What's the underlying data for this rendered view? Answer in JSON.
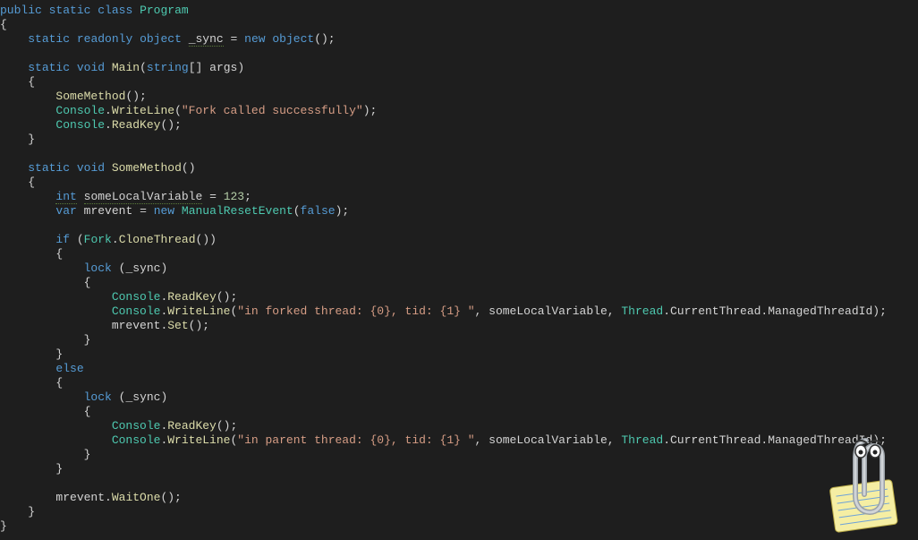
{
  "code": {
    "l1": {
      "kw1": "public",
      "kw2": "static",
      "kw3": "class",
      "name": "Program"
    },
    "l2": "{",
    "l3": {
      "kw1": "static",
      "kw2": "readonly",
      "kw3": "object",
      "field": "_sync",
      "op": "=",
      "kw4": "new",
      "kw5": "object",
      "tail": "();"
    },
    "l5": {
      "kw1": "static",
      "kw2": "void",
      "name": "Main",
      "p_kw": "string",
      "brackets": "[]",
      "param": "args"
    },
    "l6": "{",
    "l7": {
      "call": "SomeMethod",
      "tail": "();"
    },
    "l8": {
      "cls": "Console",
      "dot": ".",
      "call": "WriteLine",
      "open": "(",
      "str": "\"Fork called successfully\"",
      "close": ");"
    },
    "l9": {
      "cls": "Console",
      "dot": ".",
      "call": "ReadKey",
      "tail": "();"
    },
    "l10": "}",
    "l12": {
      "kw1": "static",
      "kw2": "void",
      "name": "SomeMethod",
      "tail": "()"
    },
    "l13": "{",
    "l14": {
      "kw": "int",
      "var": "someLocalVariable",
      "op": "=",
      "num": "123",
      "tail": ";"
    },
    "l15": {
      "kw1": "var",
      "var": "mrevent",
      "op": "=",
      "kw2": "new",
      "cls": "ManualResetEvent",
      "open": "(",
      "arg": "false",
      "close": ");"
    },
    "l17": {
      "kw": "if",
      "open": "(",
      "cls": "Fork",
      "dot": ".",
      "call": "CloneThread",
      "close": "())"
    },
    "l18": "{",
    "l19": {
      "kw": "lock",
      "open": "(",
      "var": "_sync",
      "close": ")"
    },
    "l20": "{",
    "l21": {
      "cls": "Console",
      "dot": ".",
      "call": "ReadKey",
      "tail": "();"
    },
    "l22": {
      "cls": "Console",
      "dot": ".",
      "call": "WriteLine",
      "open": "(",
      "str": "\"in forked thread: {0}, tid: {1} \"",
      "c1": ", ",
      "v1": "someLocalVariable",
      "c2": ", ",
      "cls2": "Thread",
      "dot2": ".",
      "p1": "CurrentThread",
      "dot3": ".",
      "p2": "ManagedThreadId",
      "close": ");"
    },
    "l23": {
      "var": "mrevent",
      "dot": ".",
      "call": "Set",
      "tail": "();"
    },
    "l24": "}",
    "l25": "}",
    "l26": {
      "kw": "else"
    },
    "l27": "{",
    "l28": {
      "kw": "lock",
      "open": "(",
      "var": "_sync",
      "close": ")"
    },
    "l29": "{",
    "l30": {
      "cls": "Console",
      "dot": ".",
      "call": "ReadKey",
      "tail": "();"
    },
    "l31": {
      "cls": "Console",
      "dot": ".",
      "call": "WriteLine",
      "open": "(",
      "str": "\"in parent thread: {0}, tid: {1} \"",
      "c1": ", ",
      "v1": "someLocalVariable",
      "c2": ", ",
      "cls2": "Thread",
      "dot2": ".",
      "p1": "CurrentThread",
      "dot3": ".",
      "p2": "ManagedThreadId",
      "close": ");"
    },
    "l32": "}",
    "l33": "}",
    "l35": {
      "var": "mrevent",
      "dot": ".",
      "call": "WaitOne",
      "tail": "();"
    },
    "l36": "}",
    "l37": "}"
  },
  "assistant": {
    "name": "clippy-assistant"
  }
}
